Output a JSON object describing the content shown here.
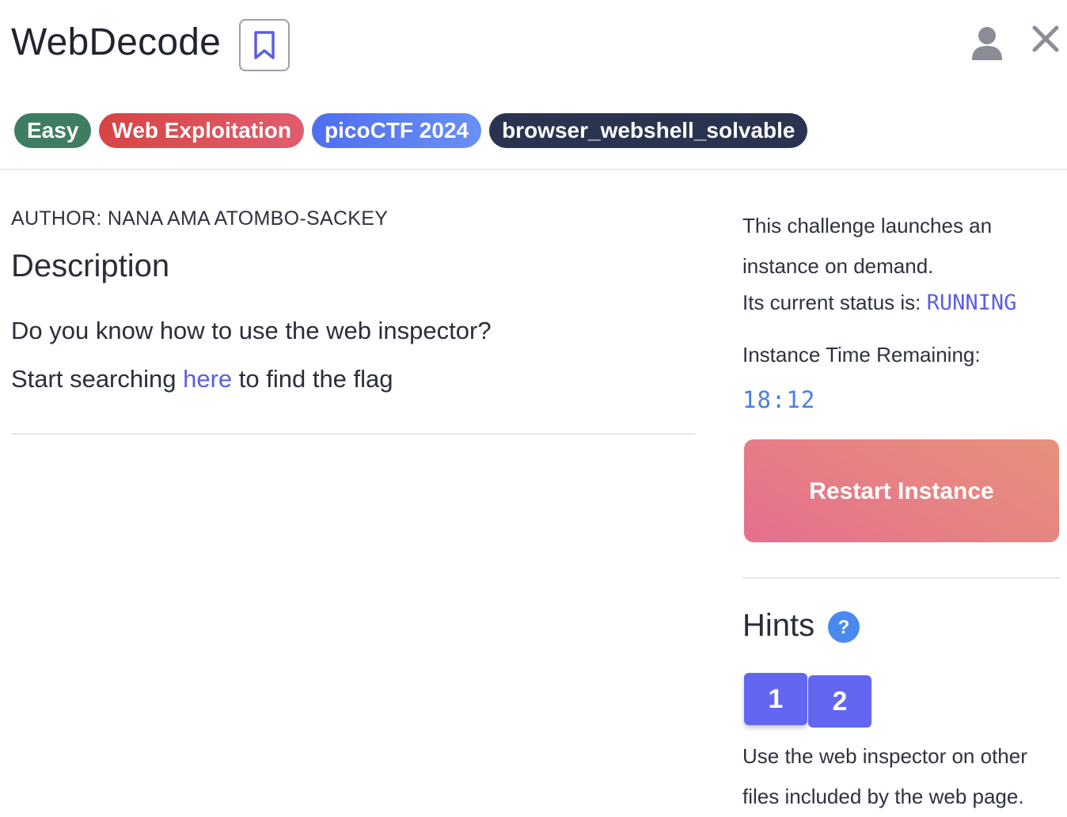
{
  "header": {
    "title": "WebDecode",
    "bookmark_icon": "bookmark-icon",
    "user_icon": "user-icon",
    "close_icon": "close-icon"
  },
  "tags": {
    "difficulty": "Easy",
    "category": "Web Exploitation",
    "event": "picoCTF 2024",
    "tool": "browser_webshell_solvable"
  },
  "main": {
    "author": "AUTHOR: NANA AMA ATOMBO-SACKEY",
    "description_heading": "Description",
    "description_line1": "Do you know how to use the web inspector?",
    "description_line2_prefix": "Start searching ",
    "description_link": "here",
    "description_line2_suffix": " to find the flag"
  },
  "instance": {
    "intro": "This challenge launches an instance on demand.",
    "status_label": "Its current status is: ",
    "status_value": "RUNNING",
    "time_label": "Instance Time Remaining:",
    "time_value": "18:12",
    "restart_label": "Restart Instance"
  },
  "hints": {
    "heading": "Hints",
    "help_icon": "question-circle-icon",
    "tabs": [
      "1",
      "2"
    ],
    "active_text": "Use the web inspector on other files included by the web page."
  },
  "colors": {
    "accent": "#6366f1",
    "link": "#5b5fe0",
    "tag_easy": "#3f7d62",
    "tag_category": "#d64545",
    "tag_event": "#4f6ef0",
    "tag_tool": "#2a3350"
  }
}
